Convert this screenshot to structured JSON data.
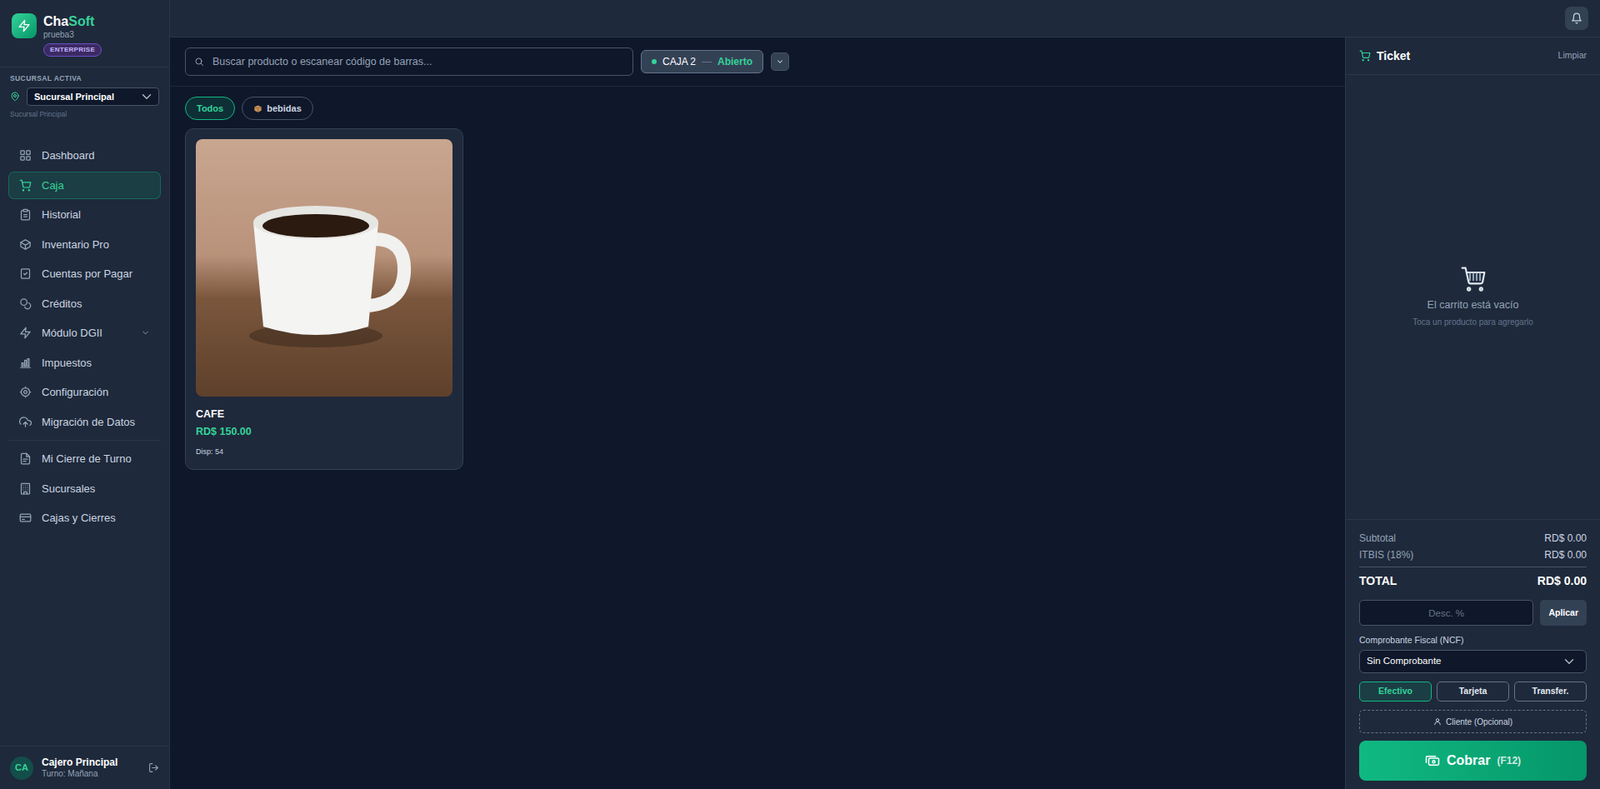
{
  "brand": {
    "name_start": "Cha",
    "name_end": "Soft",
    "tenant": "prueba3",
    "plan": "ENTERPRISE"
  },
  "branch": {
    "label": "SUCURSAL ACTIVA",
    "value": "Sucursal Principal",
    "caption": "Sucursal Principal"
  },
  "sidebar": {
    "items": [
      {
        "label": "Dashboard",
        "kind": "link",
        "selected": false
      },
      {
        "label": "Caja",
        "kind": "link",
        "selected": true
      },
      {
        "label": "Historial",
        "kind": "link",
        "selected": false
      },
      {
        "label": "Inventario Pro",
        "kind": "link",
        "selected": false
      },
      {
        "label": "Cuentas por Pagar",
        "kind": "link",
        "selected": false
      },
      {
        "label": "Créditos",
        "kind": "link",
        "selected": false
      },
      {
        "label": "Módulo DGII",
        "kind": "group",
        "selected": false,
        "expanded": false
      },
      {
        "label": "Impuestos",
        "kind": "link",
        "selected": false
      },
      {
        "label": "Configuración",
        "kind": "link",
        "selected": false
      },
      {
        "label": "Migración de Datos",
        "kind": "link",
        "selected": false
      }
    ],
    "admin_items": [
      {
        "label": "Mi Cierre de Turno",
        "kind": "link",
        "selected": false
      },
      {
        "label": "Sucursales",
        "kind": "link",
        "selected": false
      },
      {
        "label": "Cajas y Cierres",
        "kind": "link",
        "selected": false
      }
    ]
  },
  "user": {
    "initials": "CA",
    "name": "Cajero Principal",
    "shift": "Turno: Mañana"
  },
  "search": {
    "placeholder": "Buscar producto o escanear código de barras..."
  },
  "register": {
    "name": "CAJA 2",
    "separator": "—",
    "status": "Abierto",
    "open": true
  },
  "categories": [
    {
      "label": "Todos",
      "selected": true
    },
    {
      "label": "bebidas",
      "selected": false
    }
  ],
  "products": [
    {
      "name": "CAFE",
      "price": "RD$ 150.00",
      "stock": "Disp: 54"
    }
  ],
  "ticket": {
    "title": "Ticket",
    "clear": "Limpiar",
    "empty_title": "El carrito está vacío",
    "empty_hint": "Toca un producto para agregarlo"
  },
  "totals": [
    {
      "label": "Subtotal",
      "value": "RD$ 0.00",
      "kind": "line"
    },
    {
      "label": "ITBIS (18%)",
      "value": "RD$ 0.00",
      "kind": "line"
    },
    {
      "label": "TOTAL",
      "value": "RD$ 0.00",
      "kind": "grand"
    }
  ],
  "discount": {
    "placeholder": "Desc. %",
    "button": "Aplicar"
  },
  "ncf": {
    "label": "Comprobante Fiscal (NCF)",
    "value": "Sin Comprobante"
  },
  "payment_methods": [
    {
      "label": "Efectivo",
      "selected": true
    },
    {
      "label": "Tarjeta",
      "selected": false
    },
    {
      "label": "Transfer.",
      "selected": false
    }
  ],
  "client": {
    "label": "Cliente (Opcional)"
  },
  "checkout": {
    "label": "Cobrar",
    "shortcut": "(F12)"
  }
}
